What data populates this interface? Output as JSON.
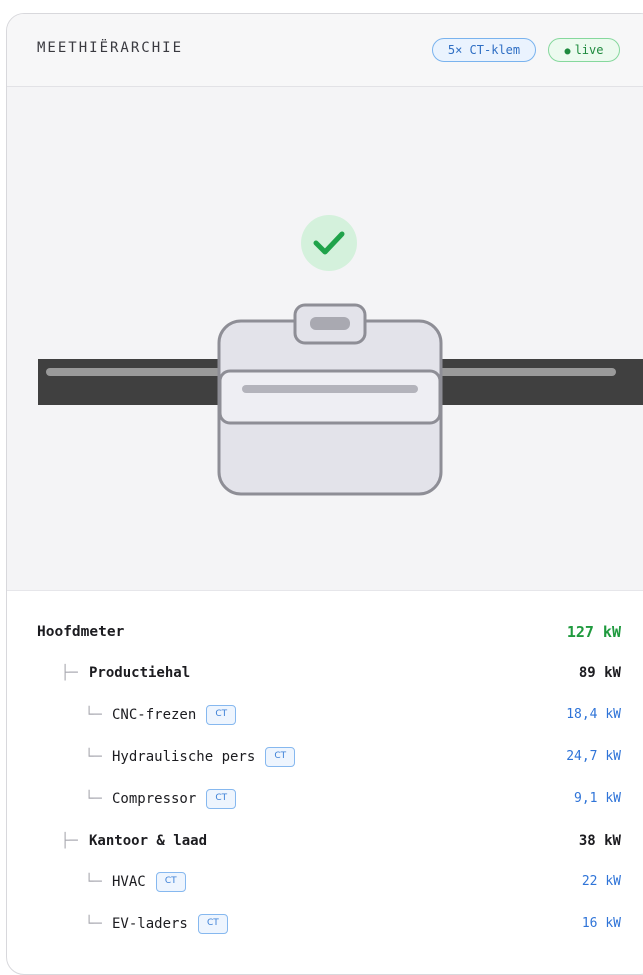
{
  "header": {
    "title": "MEETHIËRARCHIE",
    "clamp_badge": "5× CT-klem",
    "live_badge": "live"
  },
  "colors": {
    "accent_green": "#1f9a3e",
    "accent_blue": "#2f74d8",
    "clamp_body": "#e3e3ea",
    "cable": "#404040"
  },
  "stage": {
    "status_icon": "check-circle-icon",
    "device": "ct-clamp-illustration"
  },
  "tree": {
    "main": {
      "label": "Hoofdmeter",
      "value": "127 kW"
    },
    "groups": [
      {
        "label": "Productiehal",
        "value": "89 kW",
        "children": [
          {
            "label": "CNC-frezen",
            "badge": "CT",
            "value": "18,4 kW"
          },
          {
            "label": "Hydraulische pers",
            "badge": "CT",
            "value": "24,7 kW"
          },
          {
            "label": "Compressor",
            "badge": "CT",
            "value": "9,1 kW"
          }
        ]
      },
      {
        "label": "Kantoor & laad",
        "value": "38 kW",
        "children": [
          {
            "label": "HVAC",
            "badge": "CT",
            "value": "22 kW"
          },
          {
            "label": "EV-laders",
            "badge": "CT",
            "value": "16 kW"
          }
        ]
      }
    ]
  }
}
